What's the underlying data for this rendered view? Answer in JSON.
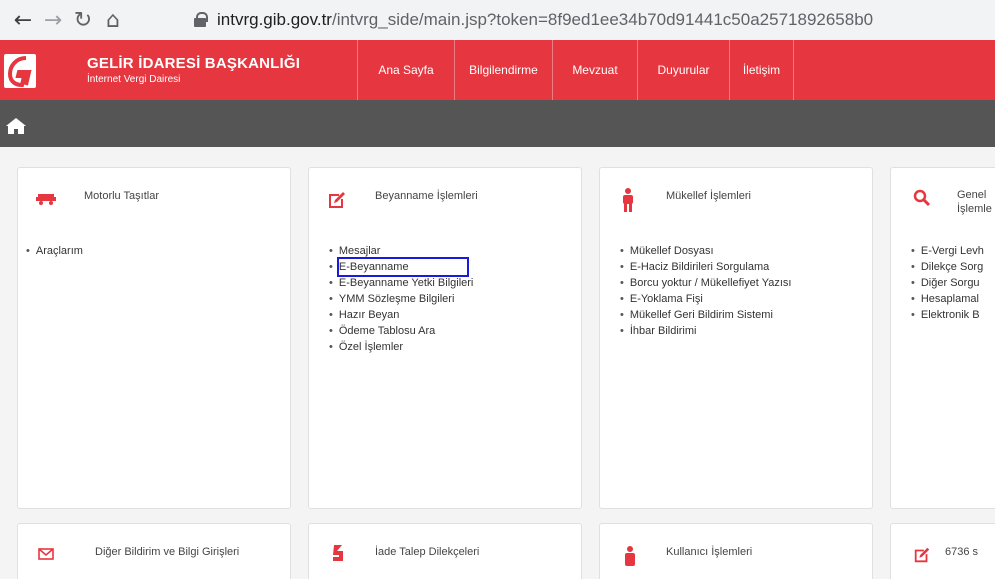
{
  "browser": {
    "url_host": "intvrg.gib.gov.tr",
    "url_path": "/intvrg_side/main.jsp?token=8f9ed1ee34b70d91441c50a2571892658b0"
  },
  "header": {
    "title": "GELİR İDARESİ BAŞKANLIĞI",
    "subtitle": "İnternet Vergi Dairesi",
    "nav": [
      "Ana Sayfa",
      "Bilgilendirme",
      "Mevzuat",
      "Duyurular",
      "İletişim"
    ]
  },
  "cards": [
    {
      "title": "Motorlu Taşıtlar",
      "icon": "car-icon",
      "items": [
        "Araçlarım"
      ]
    },
    {
      "title": "Beyanname İşlemleri",
      "icon": "edit-icon",
      "items": [
        "Mesajlar",
        "E-Beyanname",
        "E-Beyanname Yetki Bilgileri",
        "YMM Sözleşme Bilgileri",
        "Hazır Beyan",
        "Ödeme Tablosu Ara",
        "Özel İşlemler"
      ]
    },
    {
      "title": "Mükellef İşlemleri",
      "icon": "person-icon",
      "items": [
        "Mükellef Dosyası",
        "E-Haciz Bildirileri Sorgulama",
        "Borcu yoktur / Mükellefiyet Yazısı",
        "E-Yoklama Fişi",
        "Mükellef Geri Bildirim Sistemi",
        "İhbar Bildirimi"
      ]
    },
    {
      "title_line1": "Genel",
      "title_line2": "İşlemle",
      "icon": "search-icon",
      "items": [
        "E-Vergi Levh",
        "Dilekçe Sorg",
        "Diğer Sorgu",
        "Hesaplamal",
        "Elektronik B"
      ]
    }
  ],
  "bottom_cards": [
    {
      "title": "Diğer Bildirim ve Bilgi Girişleri",
      "icon": "mail-icon"
    },
    {
      "title": "İade Talep Dilekçeleri",
      "icon": "refund-icon"
    },
    {
      "title": "Kullanıcı İşlemleri",
      "icon": "user-icon"
    },
    {
      "title": "6736 s",
      "icon": "edit-icon"
    }
  ],
  "colors": {
    "header_red": "#e6363f",
    "graybar": "#555555",
    "highlight": "#1a1adf"
  }
}
